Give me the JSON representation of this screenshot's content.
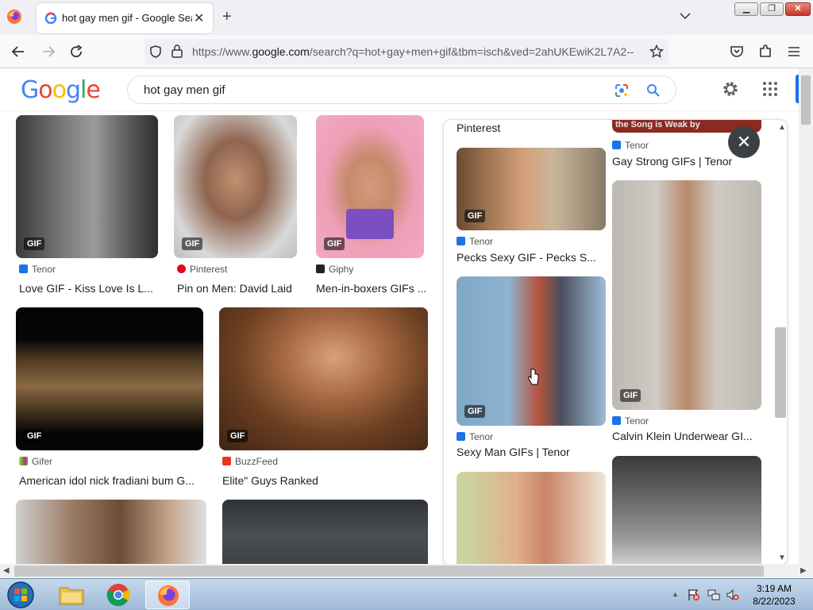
{
  "browser": {
    "tab_title": "hot gay men gif - Google Search",
    "tab_close": "✕",
    "new_tab": "+",
    "url_prefix": "https://www.",
    "url_domain": "google.com",
    "url_rest": "/search?q=hot+gay+men+gif&tbm=isch&ved=2ahUKEwiK2L7A2--"
  },
  "google": {
    "logo": "Google",
    "query": "hot gay men gif"
  },
  "results": [
    {
      "source": "Tenor",
      "caption": "Love GIF - Kiss Love Is L...",
      "badge": "GIF",
      "src_color": "#1a73e8"
    },
    {
      "source": "Pinterest",
      "caption": "Pin on Men: David Laid",
      "badge": "GIF",
      "src_color": "#e60023"
    },
    {
      "source": "Giphy",
      "caption": "Men-in-boxers GIFs ...",
      "badge": "GIF",
      "src_color": "#222222"
    },
    {
      "source": "Gifer",
      "caption": "American idol nick fradiani bum G...",
      "badge": "GIF",
      "src_color": "#7cb342"
    },
    {
      "source": "BuzzFeed",
      "caption": "Elite\" Guys Ranked",
      "badge": "GIF",
      "src_color": "#ee3322"
    }
  ],
  "panel": {
    "top_source": "Pinterest",
    "close_label": "✕",
    "col_left": [
      {
        "source": "Tenor",
        "caption": "Pecks Sexy GIF - Pecks S...",
        "badge": "GIF"
      },
      {
        "source": "Tenor",
        "caption": "Sexy Man GIFs | Tenor",
        "badge": "GIF"
      }
    ],
    "col_right": [
      {
        "source": "Tenor",
        "caption": "Gay Strong GIFs | Tenor"
      },
      {
        "source": "Tenor",
        "caption": "Calvin Klein Underwear GI...",
        "badge": "GIF"
      }
    ],
    "banner_text": "the Song is Weak by"
  },
  "taskbar": {
    "time": "3:19 AM",
    "date": "8/22/2023"
  }
}
